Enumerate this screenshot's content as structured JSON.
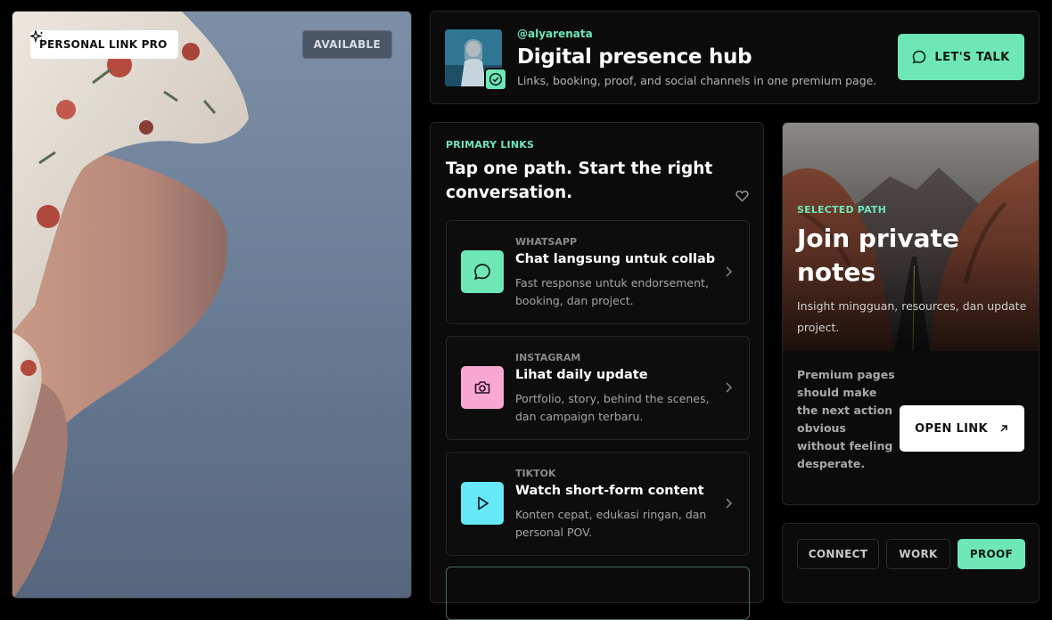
{
  "hero": {
    "badge_label": "PERSONAL LINK PRO",
    "status_label": "AVAILABLE"
  },
  "header": {
    "handle": "@alyarenata",
    "title": "Digital presence hub",
    "subtitle": "Links, booking, proof, and social channels in one premium page.",
    "cta_label": "LET'S TALK"
  },
  "links": {
    "eyebrow": "PRIMARY LINKS",
    "title": "Tap one path. Start the right conversation.",
    "items": [
      {
        "kicker": "WHATSAPP",
        "title": "Chat langsung untuk collab",
        "desc": "Fast response untuk endorsement, booking, dan project.",
        "icon": "chat-bubble-icon",
        "color": "#6ee7b7"
      },
      {
        "kicker": "INSTAGRAM",
        "title": "Lihat daily update",
        "desc": "Portfolio, story, behind the scenes, dan campaign terbaru.",
        "icon": "camera-icon",
        "color": "#f9a8d4"
      },
      {
        "kicker": "TIKTOK",
        "title": "Watch short-form content",
        "desc": "Konten cepat, edukasi ringan, dan personal POV.",
        "icon": "play-icon",
        "color": "#67e8f9"
      }
    ]
  },
  "selected_path": {
    "eyebrow": "SELECTED PATH",
    "title": "Join private notes",
    "desc": "Insight mingguan, resources, dan update project.",
    "note": "Premium pages should make the next action obvious without feeling desperate.",
    "cta_label": "OPEN LINK"
  },
  "tabs": [
    {
      "label": "CONNECT",
      "active": false
    },
    {
      "label": "WORK",
      "active": false
    },
    {
      "label": "PROOF",
      "active": true
    }
  ],
  "colors": {
    "accent": "#6ee7b7",
    "instagram": "#f9a8d4",
    "tiktok": "#67e8f9"
  }
}
